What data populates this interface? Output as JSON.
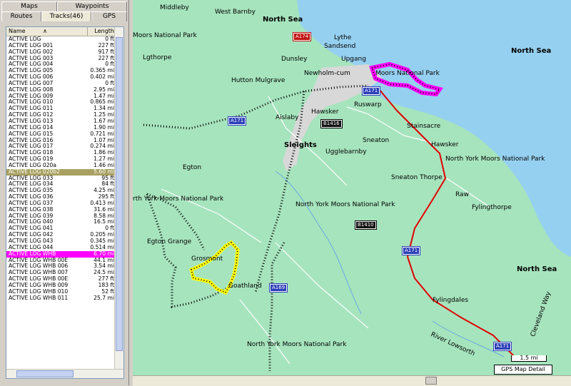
{
  "tabs": {
    "maps": "Maps",
    "waypoints": "Waypoints",
    "routes": "Routes",
    "tracks": "Tracks(46)",
    "gps": "GPS"
  },
  "list": {
    "col_name": "Name",
    "col_sort": "∧",
    "col_length": "Length",
    "rows": [
      {
        "n": "ACTIVE LOG",
        "l": "0 ft"
      },
      {
        "n": "ACTIVE LOG 001",
        "l": "227 ft"
      },
      {
        "n": "ACTIVE LOG 002",
        "l": "917 ft"
      },
      {
        "n": "ACTIVE LOG 003",
        "l": "227 ft"
      },
      {
        "n": "ACTIVE LOG 004",
        "l": "0 ft"
      },
      {
        "n": "ACTIVE LOG 005",
        "l": "0.365 mi"
      },
      {
        "n": "ACTIVE LOG 006",
        "l": "0.402 mi"
      },
      {
        "n": "ACTIVE LOG 007",
        "l": "0 ft"
      },
      {
        "n": "ACTIVE LOG 008",
        "l": "2.95 mi"
      },
      {
        "n": "ACTIVE LOG 009",
        "l": "1.47 mi"
      },
      {
        "n": "ACTIVE LOG 010",
        "l": "0.865 mi"
      },
      {
        "n": "ACTIVE LOG 011",
        "l": "1.34 mi"
      },
      {
        "n": "ACTIVE LOG 012",
        "l": "1.25 mi"
      },
      {
        "n": "ACTIVE LOG 013",
        "l": "1.67 mi"
      },
      {
        "n": "ACTIVE LOG 014",
        "l": "1.90 mi"
      },
      {
        "n": "ACTIVE LOG 015",
        "l": "0.721 mi"
      },
      {
        "n": "ACTIVE LOG 016",
        "l": "1.07 mi"
      },
      {
        "n": "ACTIVE LOG 017",
        "l": "0.274 mi"
      },
      {
        "n": "ACTIVE LOG 018",
        "l": "1.86 mi"
      },
      {
        "n": "ACTIVE LOG 019",
        "l": "1.27 mi"
      },
      {
        "n": "ACTIVE LOG 020a",
        "l": "1.46 mi"
      },
      {
        "n": "ACTIVE LOG 020b2",
        "l": "5.60 mi",
        "sel": "olive"
      },
      {
        "n": "ACTIVE LOG 033",
        "l": "95 ft"
      },
      {
        "n": "ACTIVE LOG 034",
        "l": "84 ft"
      },
      {
        "n": "ACTIVE LOG 035",
        "l": "4.25 mi"
      },
      {
        "n": "ACTIVE LOG 036",
        "l": "295 ft"
      },
      {
        "n": "ACTIVE LOG 037",
        "l": "0.413 mi"
      },
      {
        "n": "ACTIVE LOG 038",
        "l": "31.6 mi"
      },
      {
        "n": "ACTIVE LOG 039",
        "l": "8.58 mi"
      },
      {
        "n": "ACTIVE LOG 040",
        "l": "16.5 mi"
      },
      {
        "n": "ACTIVE LOG 041",
        "l": "0 ft"
      },
      {
        "n": "ACTIVE LOG 042",
        "l": "0.205 mi"
      },
      {
        "n": "ACTIVE LOG 043",
        "l": "0.345 mi"
      },
      {
        "n": "ACTIVE LOG 044",
        "l": "0.514 mi"
      },
      {
        "n": "ACTIVE LOG WHB",
        "l": "6.70 mi",
        "sel": "magenta"
      },
      {
        "n": "ACTIVE LOG WHB 00E",
        "l": "44.1 mi"
      },
      {
        "n": "ACTIVE LOG WHB 006",
        "l": "3.54 mi"
      },
      {
        "n": "ACTIVE LOG WHB 007",
        "l": "24.5 mi"
      },
      {
        "n": "ACTIVE LOG WHB 00E",
        "l": "277 ft"
      },
      {
        "n": "ACTIVE LOG WHB 009",
        "l": "183 ft"
      },
      {
        "n": "ACTIVE LOG WHB 010",
        "l": "52 ft"
      },
      {
        "n": "ACTIVE LOG WHB 011",
        "l": "25.7 mi"
      }
    ]
  },
  "map": {
    "labels": {
      "middleby": "Middleby",
      "westbarnby": "West Barnby",
      "northsea1": "North Sea",
      "moorsnp1": "Moors National Park",
      "sandsend": "Sandsend",
      "lythe": "Lythe",
      "upgang": "Upgang",
      "dunsley": "Dunsley",
      "northsea2": "North Sea",
      "lgthorpe": "Lgthorpe",
      "newholm": "Newholm-cum",
      "moorsnp2": "Moors National Park",
      "hutton": "Hutton Mulgrave",
      "ruswarp": "Ruswarp",
      "aislaby": "Aislaby",
      "hawsker1": "Hawsker",
      "stainsacre": "Stainsacre",
      "sneaton": "Sneaton",
      "sleights": "Sleights",
      "ugglebarnby": "Ugglebarnby",
      "hawsker2": "Hawsker",
      "nymnp1": "North York Moors National Park",
      "egton": "Egton",
      "sneatonthorpe": "Sneaton Thorpe",
      "raw": "Raw",
      "nymnp2": "North York Moors National Park",
      "yorkmoorsnp": "rth York Moors National Park",
      "fylingthorpe": "Fylingthorpe",
      "egtongrange": "Egton Grange",
      "northsea3": "North Sea",
      "grosmont": "Grosmont",
      "goathland": "Goathland",
      "fylingdales": "Fylingdales",
      "riverlowsorth": "River Lowsorth",
      "nymnp3": "North York Moors National Park",
      "cleveland": "Cleveland Way"
    },
    "roads": {
      "a174": "A174",
      "a171a": "A171",
      "a171b": "A171",
      "a171c": "A171",
      "a169": "A169",
      "b1410": "B1410",
      "b1416": "B1416",
      "a171d": "A171",
      "a171e": "A171"
    },
    "scale": "1.5 mi",
    "detail": "GPS Map Detail"
  },
  "colors": {
    "land": "#a6e4bd",
    "sea": "#96d0f0",
    "town": "#d8d8d8",
    "magenta": "#ff00ff",
    "yellow": "#ffff00",
    "red": "#e00000"
  }
}
